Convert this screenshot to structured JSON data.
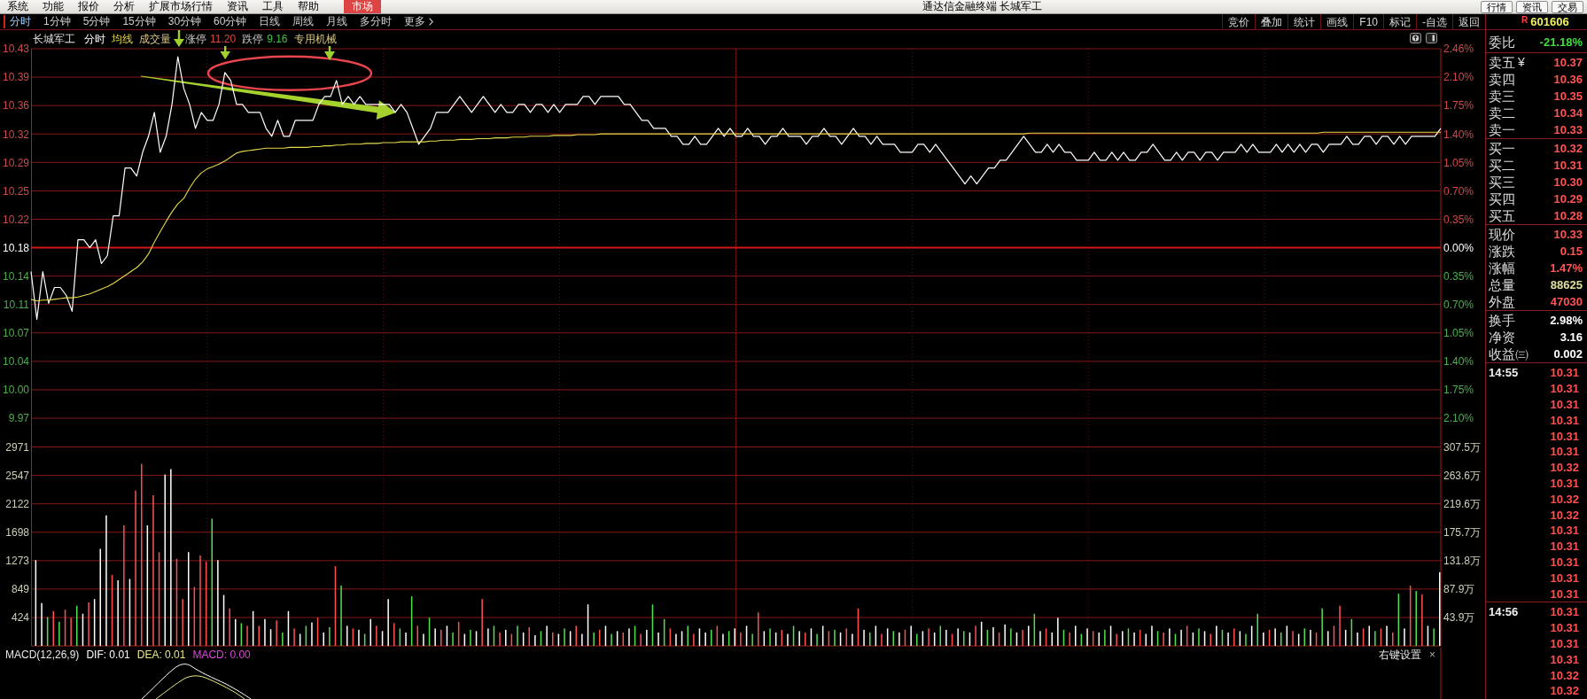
{
  "menu_bar": {
    "items": [
      {
        "label": "系统",
        "selected": false
      },
      {
        "label": "功能",
        "selected": false
      },
      {
        "label": "报价",
        "selected": false
      },
      {
        "label": "分析",
        "selected": false
      },
      {
        "label": "扩展市场行情",
        "selected": false
      },
      {
        "label": "资讯",
        "selected": false
      },
      {
        "label": "工具",
        "selected": false
      },
      {
        "label": "帮助",
        "selected": false
      },
      {
        "label": "市场",
        "selected": true
      }
    ],
    "title": "通达信金融终端 长城军工",
    "right_buttons": [
      "行情",
      "资讯",
      "交易"
    ]
  },
  "period_tabs": [
    {
      "label": "分时",
      "selected": true
    },
    {
      "label": "1分钟",
      "selected": false
    },
    {
      "label": "5分钟",
      "selected": false
    },
    {
      "label": "15分钟",
      "selected": false
    },
    {
      "label": "30分钟",
      "selected": false
    },
    {
      "label": "60分钟",
      "selected": false
    },
    {
      "label": "日线",
      "selected": false
    },
    {
      "label": "周线",
      "selected": false
    },
    {
      "label": "月线",
      "selected": false
    },
    {
      "label": "多分时",
      "selected": false
    }
  ],
  "more_menu": {
    "label": "更多"
  },
  "toolbar_buttons": [
    "竞价",
    "叠加",
    "统计",
    "画线",
    "F10",
    "标记",
    "-自选",
    "返回"
  ],
  "quote_header": {
    "badge": "R",
    "code": "601606"
  },
  "chart": {
    "stock_name": "长城军工",
    "limits": [
      {
        "label": "涨停",
        "value": "11.20",
        "color": "#d84848"
      },
      {
        "label": "跌停",
        "value": "9.16",
        "color": "#48c048"
      }
    ],
    "industry": "专用机械",
    "price_chart": {
      "chart_data": {
        "type": "line",
        "grid": true,
        "ylim": [
          9.93,
          10.43
        ],
        "yticks": [
          {
            "value": 10.43,
            "label": "10.43"
          },
          {
            "value": 10.3943,
            "label": "10.39"
          },
          {
            "value": 10.3586,
            "label": "10.36"
          },
          {
            "value": 10.3229,
            "label": "10.32"
          },
          {
            "value": 10.2871,
            "label": "10.29"
          },
          {
            "value": 10.2514,
            "label": "10.25"
          },
          {
            "value": 10.2157,
            "label": "10.22"
          },
          {
            "value": 10.18,
            "label": "10.18"
          },
          {
            "value": 10.1443,
            "label": "10.14"
          },
          {
            "value": 10.1086,
            "label": "10.11"
          },
          {
            "value": 10.0729,
            "label": "10.07"
          },
          {
            "value": 10.0371,
            "label": "10.04"
          },
          {
            "value": 10.0014,
            "label": "10.00"
          },
          {
            "value": 9.9657,
            "label": "9.97"
          }
        ],
        "series": [
          {
            "name": "分时",
            "color": "#ffffff",
            "values": [
              10.15,
              10.09,
              10.15,
              10.11,
              10.13,
              10.13,
              10.12,
              10.1,
              10.19,
              10.19,
              10.18,
              10.19,
              10.16,
              10.17,
              10.22,
              10.22,
              10.28,
              10.28,
              10.27,
              10.3,
              10.32,
              10.35,
              10.3,
              10.32,
              10.36,
              10.42,
              10.38,
              10.36,
              10.33,
              10.35,
              10.34,
              10.34,
              10.36,
              10.4,
              10.39,
              10.36,
              10.36,
              10.35,
              10.35,
              10.35,
              10.33,
              10.32,
              10.34,
              10.32,
              10.32,
              10.34,
              10.34,
              10.34,
              10.34,
              10.36,
              10.37,
              10.37,
              10.39,
              10.36,
              10.37,
              10.36,
              10.37,
              10.36,
              10.36,
              10.36,
              10.36,
              10.36,
              10.35,
              10.36,
              10.35,
              10.33,
              10.31,
              10.32,
              10.33,
              10.35,
              10.35,
              10.35,
              10.36,
              10.37,
              10.36,
              10.35,
              10.36,
              10.37,
              10.36,
              10.35,
              10.36,
              10.35,
              10.35,
              10.36,
              10.36,
              10.35,
              10.36,
              10.36,
              10.35,
              10.36,
              10.35,
              10.36,
              10.36,
              10.36,
              10.37,
              10.37,
              10.36,
              10.37,
              10.37,
              10.37,
              10.37,
              10.36,
              10.36,
              10.35,
              10.34,
              10.34,
              10.33,
              10.33,
              10.33,
              10.32,
              10.32,
              10.31,
              10.31,
              10.32,
              10.31,
              10.31,
              10.32,
              10.33,
              10.32,
              10.33,
              10.32,
              10.32,
              10.33,
              10.32,
              10.32,
              10.31,
              10.32,
              10.32,
              10.33,
              10.32,
              10.32,
              10.32,
              10.31,
              10.32,
              10.32,
              10.33,
              10.32,
              10.32,
              10.31,
              10.32,
              10.33,
              10.32,
              10.32,
              10.31,
              10.32,
              10.31,
              10.31,
              10.31,
              10.3,
              10.3,
              10.3,
              10.31,
              10.31,
              10.3,
              10.31,
              10.3,
              10.29,
              10.28,
              10.27,
              10.26,
              10.27,
              10.26,
              10.27,
              10.28,
              10.28,
              10.29,
              10.29,
              10.3,
              10.31,
              10.32,
              10.31,
              10.3,
              10.3,
              10.31,
              10.3,
              10.31,
              10.3,
              10.3,
              10.29,
              10.29,
              10.29,
              10.3,
              10.29,
              10.29,
              10.3,
              10.29,
              10.3,
              10.29,
              10.29,
              10.3,
              10.3,
              10.31,
              10.3,
              10.29,
              10.29,
              10.3,
              10.29,
              10.3,
              10.3,
              10.29,
              10.3,
              10.3,
              10.29,
              10.3,
              10.3,
              10.3,
              10.31,
              10.3,
              10.31,
              10.3,
              10.3,
              10.3,
              10.31,
              10.3,
              10.31,
              10.3,
              10.31,
              10.3,
              10.31,
              10.31,
              10.3,
              10.31,
              10.31,
              10.31,
              10.32,
              10.31,
              10.31,
              10.32,
              10.32,
              10.31,
              10.32,
              10.32,
              10.31,
              10.32,
              10.31,
              10.32,
              10.32,
              10.32,
              10.32,
              10.32,
              10.33
            ]
          },
          {
            "name": "均线",
            "color": "#e6d84a",
            "values": [
              10.115,
              10.113,
              10.114,
              10.114,
              10.115,
              10.116,
              10.117,
              10.117,
              10.118,
              10.12,
              10.122,
              10.125,
              10.128,
              10.131,
              10.135,
              10.14,
              10.145,
              10.15,
              10.155,
              10.162,
              10.172,
              10.187,
              10.2,
              10.213,
              10.225,
              10.235,
              10.242,
              10.255,
              10.266,
              10.274,
              10.279,
              10.282,
              10.285,
              10.289,
              10.294,
              10.299,
              10.301,
              10.302,
              10.303,
              10.304,
              10.305,
              10.305,
              10.305,
              10.305,
              10.306,
              10.306,
              10.306,
              10.306,
              10.307,
              10.307,
              10.308,
              10.308,
              10.309,
              10.309,
              10.31,
              10.31,
              10.31,
              10.311,
              10.311,
              10.311,
              10.312,
              10.312,
              10.312,
              10.313,
              10.313,
              10.313,
              10.313,
              10.313,
              10.314,
              10.314,
              10.315,
              10.315,
              10.315,
              10.316,
              10.316,
              10.316,
              10.317,
              10.317,
              10.317,
              10.318,
              10.318,
              10.318,
              10.319,
              10.319,
              10.319,
              10.32,
              10.32,
              10.32,
              10.32,
              10.321,
              10.321,
              10.321,
              10.321,
              10.322,
              10.322,
              10.322,
              10.322,
              10.323,
              10.323,
              10.323,
              10.323,
              10.323,
              10.323,
              10.323,
              10.323,
              10.323,
              10.323,
              10.323,
              10.323,
              10.323,
              10.323,
              10.323,
              10.323,
              10.323,
              10.323,
              10.323,
              10.323,
              10.323,
              10.323,
              10.323,
              10.323,
              10.323,
              10.323,
              10.323,
              10.323,
              10.323,
              10.323,
              10.323,
              10.323,
              10.323,
              10.323,
              10.323,
              10.323,
              10.323,
              10.323,
              10.323,
              10.323,
              10.323,
              10.323,
              10.323,
              10.323,
              10.323,
              10.323,
              10.323,
              10.323,
              10.323,
              10.323,
              10.323,
              10.323,
              10.323,
              10.323,
              10.323,
              10.323,
              10.323,
              10.323,
              10.323,
              10.323,
              10.323,
              10.323,
              10.323,
              10.323,
              10.323,
              10.323,
              10.323,
              10.323,
              10.323,
              10.323,
              10.323,
              10.323,
              10.323,
              10.324,
              10.324,
              10.324,
              10.324,
              10.324,
              10.324,
              10.324,
              10.324,
              10.324,
              10.324,
              10.324,
              10.324,
              10.324,
              10.324,
              10.324,
              10.324,
              10.324,
              10.324,
              10.324,
              10.324,
              10.324,
              10.324,
              10.324,
              10.324,
              10.324,
              10.324,
              10.324,
              10.324,
              10.324,
              10.324,
              10.324,
              10.324,
              10.324,
              10.324,
              10.324,
              10.324,
              10.324,
              10.324,
              10.324,
              10.324,
              10.324,
              10.324,
              10.324,
              10.324,
              10.324,
              10.324,
              10.324,
              10.324,
              10.324,
              10.324,
              10.325,
              10.325,
              10.325,
              10.325,
              10.325,
              10.325,
              10.325,
              10.325,
              10.325,
              10.325,
              10.325,
              10.325,
              10.325,
              10.325,
              10.325,
              10.325,
              10.325,
              10.325,
              10.325,
              10.325,
              10.325
            ]
          },
          {
            "color": "#d01818",
            "values": [
              10.18,
              10.18,
              10.18,
              10.18,
              10.18,
              10.18,
              10.18,
              10.18,
              10.18,
              10.18,
              10.18,
              10.18,
              10.18,
              10.18,
              10.18,
              10.18,
              10.18,
              10.18,
              10.18,
              10.18,
              10.18,
              10.18,
              10.18,
              10.18,
              10.18,
              10.18,
              10.18,
              10.18,
              10.18,
              10.18,
              10.18,
              10.18,
              10.18,
              10.18,
              10.18,
              10.18,
              10.18,
              10.18,
              10.18,
              10.18,
              10.18,
              10.18,
              10.18,
              10.18,
              10.18,
              10.18,
              10.18,
              10.18,
              10.18,
              10.18,
              10.18,
              10.18,
              10.18,
              10.18,
              10.18,
              10.18,
              10.18,
              10.18,
              10.18,
              10.18,
              10.18,
              10.18,
              10.18,
              10.18,
              10.18,
              10.18,
              10.18,
              10.18,
              10.18,
              10.18,
              10.18,
              10.18,
              10.18,
              10.18,
              10.18,
              10.18,
              10.18,
              10.18,
              10.18,
              10.18,
              10.18,
              10.18,
              10.18,
              10.18,
              10.18,
              10.18,
              10.18,
              10.18,
              10.18,
              10.18,
              10.18,
              10.18,
              10.18,
              10.18,
              10.18,
              10.18,
              10.18,
              10.18,
              10.18,
              10.18,
              10.18,
              10.18,
              10.18,
              10.18,
              10.18,
              10.18,
              10.18,
              10.18,
              10.18,
              10.18,
              10.18,
              10.18,
              10.18,
              10.18,
              10.18,
              10.18,
              10.18,
              10.18,
              10.18,
              10.18,
              10.18,
              10.18,
              10.18,
              10.18,
              10.18,
              10.18,
              10.18,
              10.18,
              10.18,
              10.18,
              10.18,
              10.18,
              10.18,
              10.18,
              10.18,
              10.18,
              10.18,
              10.18,
              10.18,
              10.18,
              10.18,
              10.18,
              10.18,
              10.18,
              10.18,
              10.18,
              10.18,
              10.18,
              10.18,
              10.18,
              10.18,
              10.18,
              10.18,
              10.18,
              10.18,
              10.18,
              10.18,
              10.18,
              10.18,
              10.18,
              10.18,
              10.18,
              10.18,
              10.18,
              10.18,
              10.18,
              10.18,
              10.18,
              10.18,
              10.18,
              10.18,
              10.18,
              10.18,
              10.18,
              10.18,
              10.18,
              10.18,
              10.18,
              10.18,
              10.18,
              10.18,
              10.18,
              10.18,
              10.18,
              10.18,
              10.18,
              10.18,
              10.18,
              10.18,
              10.18,
              10.18,
              10.18,
              10.18,
              10.18,
              10.18,
              10.18,
              10.18,
              10.18,
              10.18,
              10.18,
              10.18,
              10.18,
              10.18,
              10.18,
              10.18,
              10.18,
              10.18,
              10.18,
              10.18,
              10.18,
              10.18,
              10.18,
              10.18,
              10.18,
              10.18,
              10.18,
              10.18,
              10.18,
              10.18,
              10.18,
              10.18,
              10.18,
              10.18,
              10.18,
              10.18,
              10.18,
              10.18,
              10.18,
              10.18,
              10.18,
              10.18,
              10.18,
              10.18,
              10.18,
              10.18,
              10.18,
              10.18,
              10.18,
              10.18,
              10.18,
              10.18
            ]
          }
        ]
      },
      "right_ticks": [
        "2.46%",
        "2.10%",
        "1.75%",
        "1.40%",
        "1.05%",
        "0.70%",
        "0.35%",
        "0.00%",
        "0.35%",
        "0.70%",
        "1.05%",
        "1.40%",
        "1.75%",
        "2.10%"
      ]
    },
    "volume_chart": {
      "chart_data": {
        "type": "bar",
        "grid": true,
        "title": "成交量",
        "ylim": [
          0,
          2971
        ],
        "yticks": [
          2971,
          2547,
          2122,
          1698,
          1273,
          849,
          424
        ],
        "series": [
          {
            "color": "#ff5050",
            "values": [
              null,
              null,
              null,
              520,
              null,
              540,
              420,
              null,
              null,
              650,
              null,
              null,
              null,
              1060,
              null,
              1800,
              null,
              2320,
              2720,
              null,
              2250,
              1400,
              null,
              null,
              1300,
              700,
              null,
              880,
              1350,
              1260,
              null,
              null,
              null,
              560,
              null,
              null,
              300,
              null,
              300,
              null,
              null,
              380,
              null,
              null,
              260,
              null,
              null,
              null,
              420,
              null,
              null,
              1190,
              null,
              null,
              260,
              null,
              null,
              null,
              300,
              null,
              null,
              340,
              null,
              null,
              null,
              300,
              null,
              null,
              null,
              240,
              null,
              null,
              360,
              null,
              null,
              null,
              700,
              null,
              null,
              200,
              null,
              180,
              null,
              null,
              280,
              null,
              null,
              null,
              200,
              null,
              null,
              null,
              300,
              null,
              null,
              null,
              240,
              null,
              null,
              null,
              200,
              null,
              null,
              180,
              null,
              null,
              null,
              null,
              260,
              null,
              null,
              null,
              180,
              null,
              null,
              null,
              300,
              null,
              null,
              null,
              200,
              null,
              null,
              500,
              null,
              null,
              null,
              240,
              null,
              null,
              null,
              200,
              null,
              null,
              null,
              220,
              null,
              null,
              260,
              null,
              560,
              null,
              null,
              null,
              180,
              null,
              null,
              null,
              240,
              null,
              null,
              null,
              260,
              null,
              null,
              null,
              180,
              null,
              null,
              null,
              300,
              null,
              null,
              null,
              200,
              null,
              null,
              null,
              240,
              null,
              null,
              null,
              260,
              null,
              null,
              null,
              200,
              null,
              null,
              null,
              220,
              null,
              null,
              null,
              180,
              null,
              null,
              null,
              240,
              null,
              null,
              null,
              200,
              null,
              null,
              null,
              300,
              null,
              null,
              null,
              180,
              null,
              null,
              null,
              260,
              null,
              null,
              null,
              null,
              null,
              240,
              null,
              null,
              null,
              220,
              null,
              null,
              null,
              200,
              null,
              null,
              300,
              600,
              null,
              null,
              null,
              260,
              null,
              null,
              260,
              null,
              200,
              null,
              null,
              900,
              null,
              770,
              null,
              null,
              null
            ]
          },
          {
            "color": "#50e050",
            "values": [
              null,
              null,
              430,
              null,
              360,
              null,
              null,
              600,
              null,
              null,
              null,
              null,
              null,
              null,
              null,
              null,
              null,
              null,
              null,
              null,
              null,
              null,
              null,
              null,
              null,
              null,
              null,
              null,
              null,
              null,
              1900,
              null,
              null,
              null,
              null,
              340,
              null,
              null,
              null,
              null,
              null,
              null,
              200,
              null,
              null,
              null,
              300,
              null,
              null,
              null,
              280,
              null,
              900,
              null,
              null,
              null,
              180,
              null,
              null,
              null,
              null,
              null,
              260,
              null,
              740,
              null,
              null,
              420,
              null,
              null,
              null,
              200,
              null,
              null,
              240,
              null,
              null,
              null,
              300,
              null,
              null,
              null,
              300,
              null,
              null,
              null,
              220,
              null,
              null,
              null,
              260,
              null,
              null,
              null,
              null,
              200,
              null,
              null,
              180,
              null,
              null,
              null,
              300,
              null,
              null,
              620,
              null,
              400,
              null,
              null,
              null,
              300,
              null,
              null,
              null,
              240,
              null,
              null,
              220,
              null,
              null,
              null,
              180,
              null,
              null,
              260,
              null,
              null,
              null,
              300,
              null,
              null,
              null,
              180,
              null,
              null,
              240,
              null,
              null,
              null,
              null,
              null,
              200,
              null,
              null,
              null,
              220,
              null,
              null,
              null,
              180,
              null,
              null,
              null,
              300,
              null,
              null,
              null,
              220,
              null,
              null,
              null,
              240,
              null,
              null,
              null,
              260,
              null,
              null,
              null,
              480,
              null,
              null,
              null,
              null,
              240,
              null,
              null,
              180,
              null,
              null,
              null,
              240,
              null,
              null,
              null,
              260,
              null,
              null,
              null,
              null,
              220,
              null,
              null,
              180,
              null,
              null,
              null,
              260,
              null,
              null,
              null,
              240,
              null,
              null,
              null,
              180,
              null,
              480,
              null,
              null,
              null,
              200,
              null,
              null,
              null,
              260,
              null,
              null,
              560,
              null,
              null,
              null,
              null,
              400,
              null,
              null,
              null,
              220,
              null,
              null,
              null,
              780,
              null,
              null,
              820,
              null,
              null,
              260,
              null
            ]
          },
          {
            "color": "#ffffff",
            "values": [
              1280,
              640,
              null,
              null,
              null,
              null,
              null,
              null,
              480,
              null,
              700,
              1450,
              1950,
              null,
              980,
              null,
              1000,
              null,
              null,
              1800,
              null,
              null,
              2560,
              2640,
              null,
              null,
              1400,
              null,
              null,
              null,
              null,
              1280,
              760,
              null,
              400,
              null,
              null,
              520,
              null,
              400,
              250,
              null,
              null,
              520,
              null,
              180,
              null,
              350,
              null,
              200,
              null,
              null,
              null,
              300,
              null,
              240,
              null,
              400,
              null,
              220,
              700,
              null,
              null,
              200,
              null,
              null,
              180,
              null,
              260,
              null,
              300,
              null,
              null,
              180,
              null,
              220,
              null,
              260,
              null,
              null,
              240,
              null,
              null,
              200,
              null,
              160,
              null,
              300,
              null,
              180,
              null,
              220,
              null,
              180,
              620,
              null,
              null,
              300,
              null,
              220,
              null,
              260,
              null,
              null,
              240,
              null,
              200,
              null,
              null,
              180,
              220,
              null,
              null,
              260,
              200,
              null,
              null,
              180,
              null,
              260,
              null,
              300,
              null,
              null,
              220,
              null,
              200,
              null,
              180,
              null,
              220,
              null,
              260,
              null,
              300,
              null,
              null,
              200,
              null,
              180,
              null,
              240,
              null,
              300,
              null,
              260,
              null,
              200,
              null,
              300,
              null,
              220,
              null,
              200,
              null,
              240,
              null,
              260,
              null,
              200,
              null,
              360,
              null,
              280,
              null,
              320,
              null,
              200,
              null,
              300,
              null,
              220,
              null,
              200,
              420,
              null,
              null,
              300,
              null,
              260,
              null,
              200,
              null,
              300,
              null,
              220,
              null,
              200,
              null,
              180,
              300,
              null,
              null,
              260,
              null,
              240,
              null,
              200,
              null,
              220,
              null,
              300,
              null,
              200,
              null,
              220,
              null,
              300,
              null,
              200,
              null,
              260,
              null,
              300,
              null,
              180,
              null,
              240,
              null,
              null,
              220,
              null,
              null,
              240,
              null,
              200,
              null,
              300,
              null,
              null,
              300,
              null,
              null,
              260,
              null,
              null,
              null,
              300,
              null,
              1100
            ]
          }
        ]
      },
      "right_ticks": [
        "307.5万",
        "263.6万",
        "219.6万",
        "175.7万",
        "131.8万",
        "87.9万",
        "43.9万"
      ]
    },
    "macd": {
      "title": "MACD(12,26,9)",
      "items": [
        {
          "label": "DIF: 0.01",
          "color": "#ffffff"
        },
        {
          "label": "DEA: 0.01",
          "color": "#e8e880"
        },
        {
          "label": "MACD: 0.00",
          "color": "#d848d8"
        }
      ],
      "settings": "右键设置",
      "close": "×"
    }
  },
  "quote_panel": {
    "ratio": {
      "label": "委比",
      "value": "-21.18%",
      "color": "#40dc40"
    },
    "groups": [
      [
        {
          "label": "卖五",
          "suffix": "¥",
          "value": "10.37",
          "color": "#ff5454"
        },
        {
          "label": "卖四",
          "value": "10.36",
          "color": "#ff5454"
        },
        {
          "label": "卖三",
          "value": "10.35",
          "color": "#ff5454"
        },
        {
          "label": "卖二",
          "value": "10.34",
          "color": "#ff5454"
        },
        {
          "label": "卖一",
          "value": "10.33",
          "color": "#ff5454"
        }
      ],
      [
        {
          "label": "买一",
          "value": "10.32",
          "color": "#ff5454"
        },
        {
          "label": "买二",
          "value": "10.31",
          "color": "#ff5454"
        },
        {
          "label": "买三",
          "value": "10.30",
          "color": "#ff5454"
        },
        {
          "label": "买四",
          "value": "10.29",
          "color": "#ff5454"
        },
        {
          "label": "买五",
          "value": "10.28",
          "color": "#ff5454"
        }
      ],
      [
        {
          "label": "现价",
          "value": "10.33",
          "color": "#ff5454"
        },
        {
          "label": "涨跌",
          "value": "0.15",
          "color": "#ff5454"
        },
        {
          "label": "涨幅",
          "value": "1.47%",
          "color": "#ff5454"
        },
        {
          "label": "总量",
          "value": "88625",
          "color": "#e0e09c"
        },
        {
          "label": "外盘",
          "value": "47030",
          "color": "#ff5454"
        }
      ],
      [
        {
          "label": "换手",
          "value": "2.98%",
          "color": "#ffffff"
        },
        {
          "label": "净资",
          "value": "3.16",
          "color": "#ffffff"
        },
        {
          "label": "收益㈢",
          "value": "0.002",
          "color": "#ffffff"
        }
      ]
    ]
  },
  "time_sales": [
    {
      "time": "14:55",
      "prices": [
        "10.31",
        "10.31",
        "10.31",
        "10.31",
        "10.31",
        "10.31",
        "10.32",
        "10.31",
        "10.32",
        "10.32",
        "10.31",
        "10.31",
        "10.31",
        "10.31",
        "10.31"
      ]
    },
    {
      "time": "14:56",
      "prices": [
        "10.31",
        "10.31",
        "10.31",
        "10.31",
        "10.32",
        "10.32"
      ]
    }
  ]
}
